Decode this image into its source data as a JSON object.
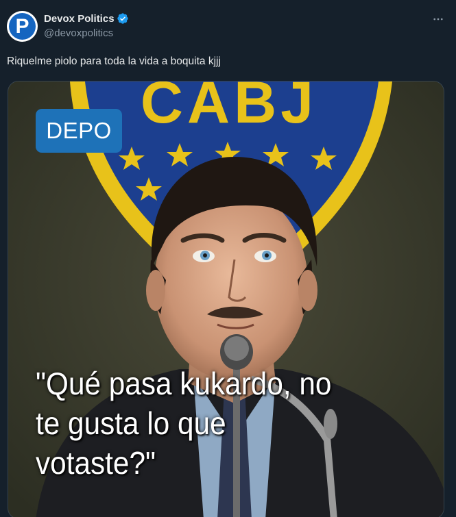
{
  "author": {
    "display_name": "Devox Politics",
    "handle": "@devoxpolitics",
    "avatar_letter": "P",
    "verified": true,
    "verified_color": "#1d9bf0",
    "avatar_color": "#1565c0"
  },
  "tweet": {
    "text": "Riquelme piolo para toda la vida a boquita kjjj"
  },
  "media": {
    "badge_label": "DEPO",
    "badge_color": "#1e72b8",
    "crest_text": "CABJ",
    "crest_colors": {
      "blue": "#1c3f8f",
      "gold": "#e8c21a"
    },
    "quote_lines": [
      "\"Qué pasa kukardo, no",
      "te gusta lo que",
      "votaste?\""
    ]
  },
  "icons": {
    "more": "more-dots-icon",
    "verified": "verified-badge-icon"
  },
  "colors": {
    "background": "#15202b",
    "text_primary": "#e7e9ea",
    "text_secondary": "#8b98a5"
  }
}
